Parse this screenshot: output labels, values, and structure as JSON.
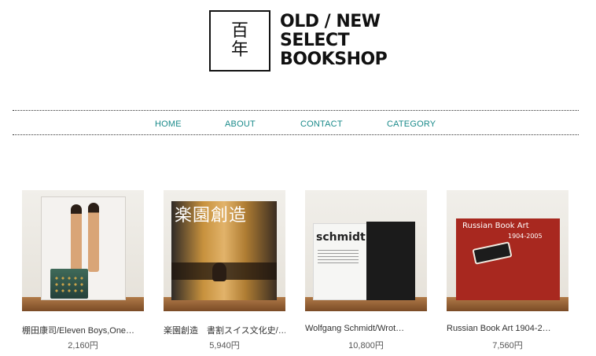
{
  "logo": {
    "glyph_top": "百",
    "glyph_bottom": "年",
    "lines": [
      "OLD / NEW",
      "SELECT",
      "BOOKSHOP"
    ]
  },
  "nav": {
    "items": [
      {
        "label": "HOME"
      },
      {
        "label": "ABOUT"
      },
      {
        "label": "CONTACT"
      },
      {
        "label": "CATEGORY"
      }
    ]
  },
  "products": [
    {
      "title": "棚田康司/Eleven Boys,One…",
      "price": "2,160円"
    },
    {
      "title": "楽園創造　書割スイス文化史/…",
      "price": "5,940円",
      "cover_text": "楽園創造"
    },
    {
      "title": "Wolfgang Schmidt/Wrot…",
      "price": "10,800円",
      "cover_text": "schmidt"
    },
    {
      "title": "Russian Book Art 1904-2…",
      "price": "7,560円",
      "cover_text": "Russian Book Art",
      "cover_year": "1904-2005"
    }
  ],
  "colors": {
    "nav_link": "#1a8a8a",
    "text": "#333333",
    "logo": "#111111"
  }
}
